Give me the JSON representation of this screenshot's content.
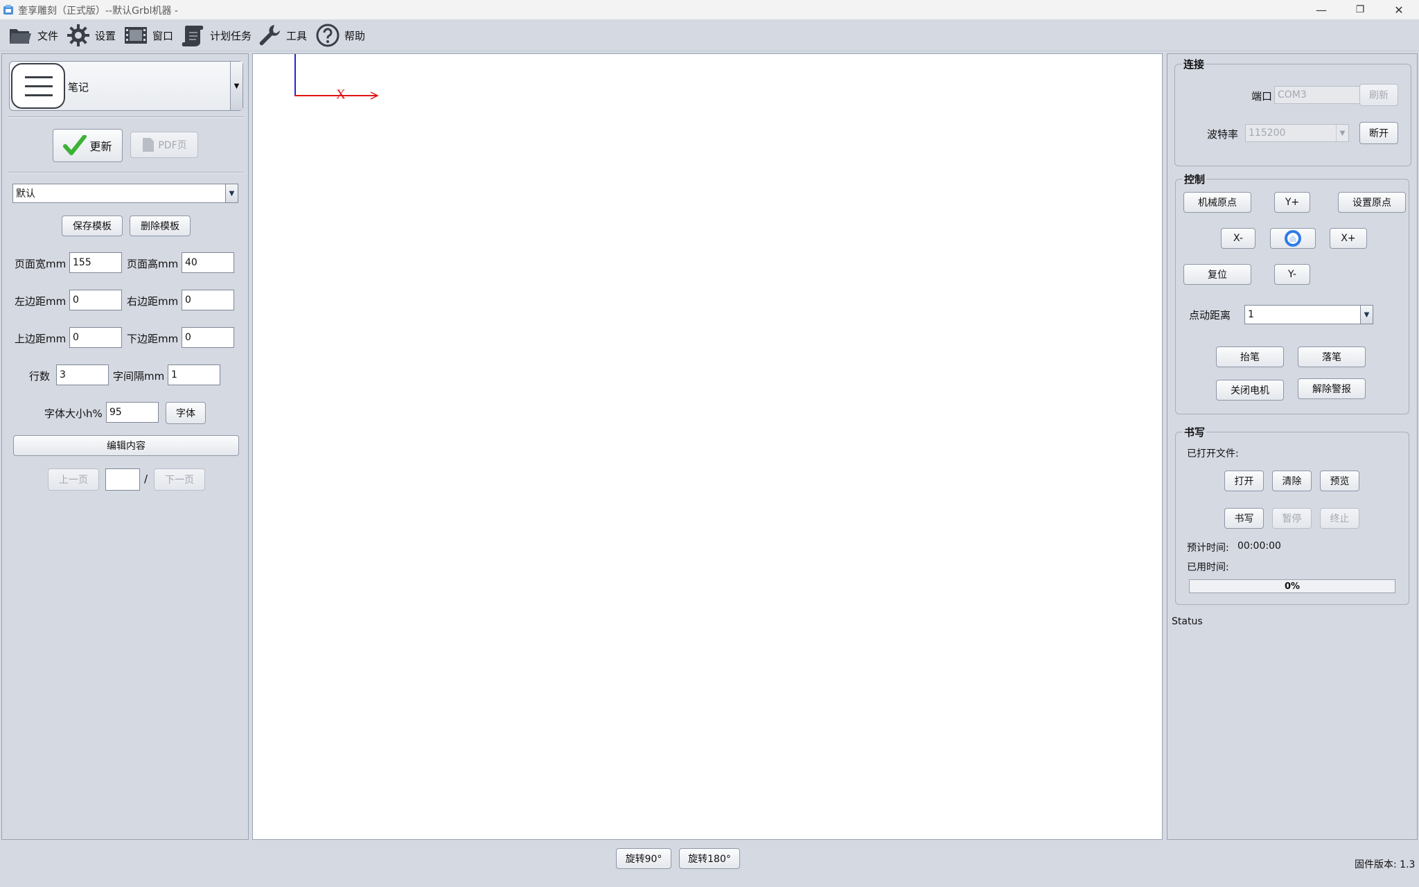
{
  "window": {
    "title": "奎享雕刻（正式版）--默认Grbl机器 -",
    "minimize_glyph": "—",
    "maximize_glyph": "❐",
    "close_glyph": "✕"
  },
  "menu": {
    "items": [
      {
        "label": "文件",
        "icon": "folder-icon"
      },
      {
        "label": "设置",
        "icon": "gear-icon"
      },
      {
        "label": "窗口",
        "icon": "film-window-icon"
      },
      {
        "label": "计划任务",
        "icon": "scroll-icon"
      },
      {
        "label": "工具",
        "icon": "wrench-icon"
      },
      {
        "label": "帮助",
        "icon": "help-icon"
      }
    ]
  },
  "left": {
    "mode_label": "笔记",
    "update_label": "更新",
    "pdf_label": "PDF页",
    "template_value": "默认",
    "save_template": "保存模板",
    "delete_template": "删除模板",
    "page_width_label": "页面宽mm",
    "page_width": "155",
    "page_height_label": "页面高mm",
    "page_height": "40",
    "left_margin_label": "左边距mm",
    "left_margin": "0",
    "right_margin_label": "右边距mm",
    "right_margin": "0",
    "top_margin_label": "上边距mm",
    "top_margin": "0",
    "bottom_margin_label": "下边距mm",
    "bottom_margin": "0",
    "rows_label": "行数",
    "rows": "3",
    "char_spacing_label": "字间隔mm",
    "char_spacing": "1",
    "font_size_label": "字体大小h%",
    "font_size": "95",
    "font_button": "字体",
    "edit_content": "编辑内容",
    "prev_page": "上一页",
    "page_input": "",
    "page_sep": "/",
    "next_page": "下一页"
  },
  "canvas": {
    "x_axis_label": "X"
  },
  "right": {
    "connect": {
      "legend": "连接",
      "port_label": "端口",
      "port_value": "COM3",
      "refresh": "刷新",
      "baud_label": "波特率",
      "baud_value": "115200",
      "disconnect": "断开"
    },
    "control": {
      "legend": "控制",
      "machine_home": "机械原点",
      "y_plus": "Y+",
      "set_origin": "设置原点",
      "x_minus": "X-",
      "x_plus": "X+",
      "reset": "复位",
      "y_minus": "Y-",
      "jog_distance_label": "点动距离",
      "jog_distance": "1",
      "pen_up": "抬笔",
      "pen_down": "落笔",
      "motor_off": "关闭电机",
      "clear_alarm": "解除警报"
    },
    "write": {
      "legend": "书写",
      "opened_file_label": "已打开文件:",
      "open": "打开",
      "clear": "清除",
      "preview": "预览",
      "write": "书写",
      "pause": "暂停",
      "stop": "终止",
      "estimated_label": "预计时间:",
      "estimated_value": "00:00:00",
      "elapsed_label": "已用时间:",
      "progress_text": "0%",
      "progress": 0
    },
    "status_label": "Status"
  },
  "bottom": {
    "rotate90": "旋转90°",
    "rotate180": "旋转180°",
    "firmware": "固件版本: 1.3"
  },
  "colors": {
    "accent_blue": "#2f7be8",
    "axis_red": "#e01515",
    "axis_blue": "#2222dd",
    "check_green": "#3bb234"
  }
}
